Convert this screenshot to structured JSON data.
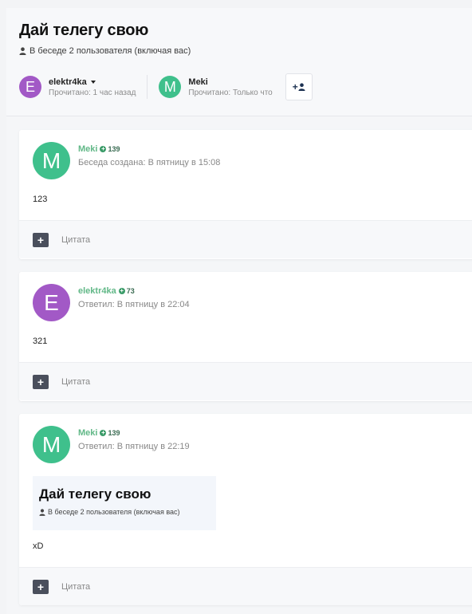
{
  "conversation": {
    "title": "Дай телегу свою",
    "subtitle": "В беседе 2 пользователя (включая вас)"
  },
  "participants": [
    {
      "initial": "E",
      "name": "elektr4ka",
      "read": "Прочитано: 1 час назад",
      "color": "#a259c6"
    },
    {
      "initial": "M",
      "name": "Meki",
      "read": "Прочитано: Только что",
      "color": "#3fc08c"
    }
  ],
  "invite": {
    "label": "+"
  },
  "messages": [
    {
      "initial": "M",
      "color": "#3fc08c",
      "author": "Meki",
      "rep": "139",
      "meta": "Беседа создана: В пятницу в 15:08",
      "body": "123",
      "quote_label": "Цитата"
    },
    {
      "initial": "E",
      "color": "#a259c6",
      "author": "elektr4ka",
      "rep": "73",
      "meta": "Ответил: В пятницу в 22:04",
      "body": "321",
      "quote_label": "Цитата"
    },
    {
      "initial": "M",
      "color": "#3fc08c",
      "author": "Meki",
      "rep": "139",
      "meta": "Ответил: В пятницу в 22:19",
      "embed_title": "Дай телегу свою",
      "embed_sub": "В беседе 2 пользователя (включая вас)",
      "body": "xD",
      "quote_label": "Цитата"
    }
  ]
}
